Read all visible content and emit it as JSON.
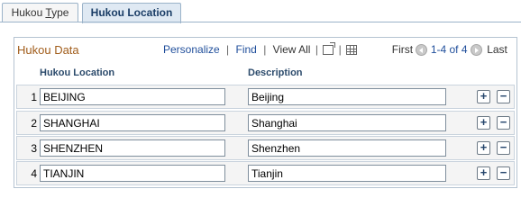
{
  "tabs": [
    {
      "label_prefix": "Hukou ",
      "label_underlined": "T",
      "label_suffix": "ype"
    },
    {
      "label": "Hukou Location"
    }
  ],
  "grid": {
    "title": "Hukou Data",
    "toolbar": {
      "personalize": "Personalize",
      "find": "Find",
      "view_all": "View All",
      "first": "First",
      "range": "1-4 of 4",
      "last": "Last"
    },
    "columns": {
      "location": "Hukou Location",
      "description": "Description"
    },
    "rows": [
      {
        "num": "1",
        "location": "BEIJING",
        "description": "Beijing"
      },
      {
        "num": "2",
        "location": "SHANGHAI",
        "description": "Shanghai"
      },
      {
        "num": "3",
        "location": "SHENZHEN",
        "description": "Shenzhen"
      },
      {
        "num": "4",
        "location": "TIANJIN",
        "description": "Tianjin"
      }
    ],
    "add_label": "+",
    "delete_label": "−"
  },
  "icons": [
    "zoom-icon",
    "grid-icon",
    "prev-icon",
    "next-icon",
    "add-row-icon",
    "delete-row-icon"
  ],
  "colors": {
    "grid_title": "#a15d1b",
    "link": "#1f4e9b",
    "active_tab": "#dfe9f3"
  }
}
